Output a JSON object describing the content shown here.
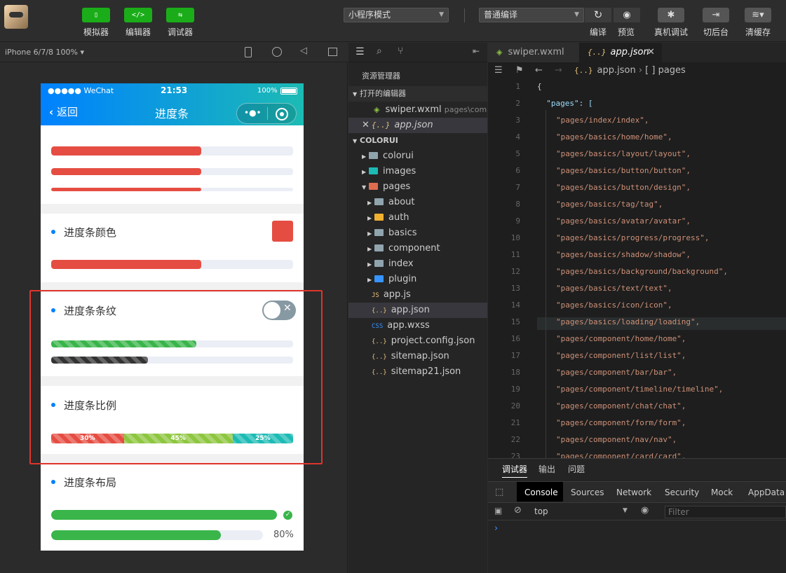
{
  "toolbar": {
    "simulator": {
      "label": "模拟器",
      "icon": "phone-icon"
    },
    "editor": {
      "label": "编辑器",
      "icon": "code-icon"
    },
    "debugger": {
      "label": "调试器",
      "icon": "sliders-icon"
    },
    "mode_select": "小程序模式",
    "compile_select": "普通编译",
    "compile": "编译",
    "preview": "预览",
    "remote_debug": "真机调试",
    "background": "切后台",
    "clear_cache": "清缓存"
  },
  "simbar": {
    "device": "iPhone 6/7/8 100%"
  },
  "phone": {
    "status": {
      "carrier": "●●●●● WeChat",
      "time": "21:53",
      "battery": "100%"
    },
    "nav": {
      "back": "返回",
      "title": "进度条"
    },
    "top_bars_progress": [
      0.62,
      0.62,
      0.62
    ],
    "section_color": {
      "title": "进度条颜色",
      "progress": 0.62,
      "swatch_color": "#e54d42"
    },
    "section_stripe": {
      "title": "进度条条纹",
      "green_progress": 0.6,
      "black_progress": 0.4
    },
    "section_ratio": {
      "title": "进度条比例",
      "segments": [
        {
          "label": "30%",
          "value": 30,
          "color": "#e54d42"
        },
        {
          "label": "45%",
          "value": 45,
          "color": "#8dc63f"
        },
        {
          "label": "25%",
          "value": 25,
          "color": "#1cbbb4"
        }
      ]
    },
    "section_layout": {
      "title": "进度条布局",
      "full_progress": 1.0,
      "progress": 0.8,
      "percent_label": "80%"
    }
  },
  "explorer": {
    "title": "资源管理器",
    "open_editors": "打开的编辑器",
    "open_files": [
      {
        "name": "swiper.wxml",
        "path": "pages\\com..."
      },
      {
        "name": "app.json",
        "path": ""
      }
    ],
    "project": "COLORUI",
    "tree": [
      {
        "name": "colorui",
        "type": "folder",
        "depth": 0
      },
      {
        "name": "images",
        "type": "folder",
        "depth": 0
      },
      {
        "name": "pages",
        "type": "folder-open",
        "depth": 0
      },
      {
        "name": "about",
        "type": "folder",
        "depth": 1
      },
      {
        "name": "auth",
        "type": "folder",
        "depth": 1
      },
      {
        "name": "basics",
        "type": "folder",
        "depth": 1
      },
      {
        "name": "component",
        "type": "folder",
        "depth": 1
      },
      {
        "name": "index",
        "type": "folder",
        "depth": 1
      },
      {
        "name": "plugin",
        "type": "folder",
        "depth": 1
      },
      {
        "name": "app.js",
        "type": "js",
        "depth": 0
      },
      {
        "name": "app.json",
        "type": "json",
        "depth": 0
      },
      {
        "name": "app.wxss",
        "type": "css",
        "depth": 0
      },
      {
        "name": "project.config.json",
        "type": "json",
        "depth": 0
      },
      {
        "name": "sitemap.json",
        "type": "json",
        "depth": 0
      },
      {
        "name": "sitemap21.json",
        "type": "json",
        "depth": 0
      }
    ]
  },
  "editor": {
    "tabs": [
      {
        "name": "swiper.wxml",
        "active": false
      },
      {
        "name": "app.json",
        "active": true
      }
    ],
    "breadcrumb": [
      "app.json",
      "[ ] pages"
    ],
    "lines": [
      {
        "n": "1",
        "text": "{"
      },
      {
        "n": "2",
        "text": "  \"pages\": ["
      },
      {
        "n": "3",
        "text": "\"pages/index/index\","
      },
      {
        "n": "4",
        "text": "\"pages/basics/home/home\","
      },
      {
        "n": "5",
        "text": "\"pages/basics/layout/layout\","
      },
      {
        "n": "6",
        "text": "\"pages/basics/button/button\","
      },
      {
        "n": "7",
        "text": "\"pages/basics/button/design\","
      },
      {
        "n": "8",
        "text": "\"pages/basics/tag/tag\","
      },
      {
        "n": "9",
        "text": "\"pages/basics/avatar/avatar\","
      },
      {
        "n": "10",
        "text": "\"pages/basics/progress/progress\","
      },
      {
        "n": "11",
        "text": "\"pages/basics/shadow/shadow\","
      },
      {
        "n": "12",
        "text": "\"pages/basics/background/background\","
      },
      {
        "n": "13",
        "text": "\"pages/basics/text/text\","
      },
      {
        "n": "14",
        "text": "\"pages/basics/icon/icon\","
      },
      {
        "n": "15",
        "text": "\"pages/basics/loading/loading\","
      },
      {
        "n": "16",
        "text": "\"pages/component/home/home\","
      },
      {
        "n": "17",
        "text": "\"pages/component/list/list\","
      },
      {
        "n": "18",
        "text": "\"pages/component/bar/bar\","
      },
      {
        "n": "19",
        "text": "\"pages/component/timeline/timeline\","
      },
      {
        "n": "20",
        "text": "\"pages/component/chat/chat\","
      },
      {
        "n": "21",
        "text": "\"pages/component/form/form\","
      },
      {
        "n": "22",
        "text": "\"pages/component/nav/nav\","
      },
      {
        "n": "23",
        "text": "\"pages/component/card/card\","
      }
    ]
  },
  "console": {
    "panel_tabs": [
      "调试器",
      "输出",
      "问题"
    ],
    "devtools_tabs": [
      "Console",
      "Sources",
      "Network",
      "Security",
      "Mock",
      "AppData"
    ],
    "context": "top",
    "filter_placeholder": "Filter",
    "prompt": "›"
  },
  "colors": {
    "highlight_box": "#e0342c",
    "accent": "#1aad19"
  }
}
